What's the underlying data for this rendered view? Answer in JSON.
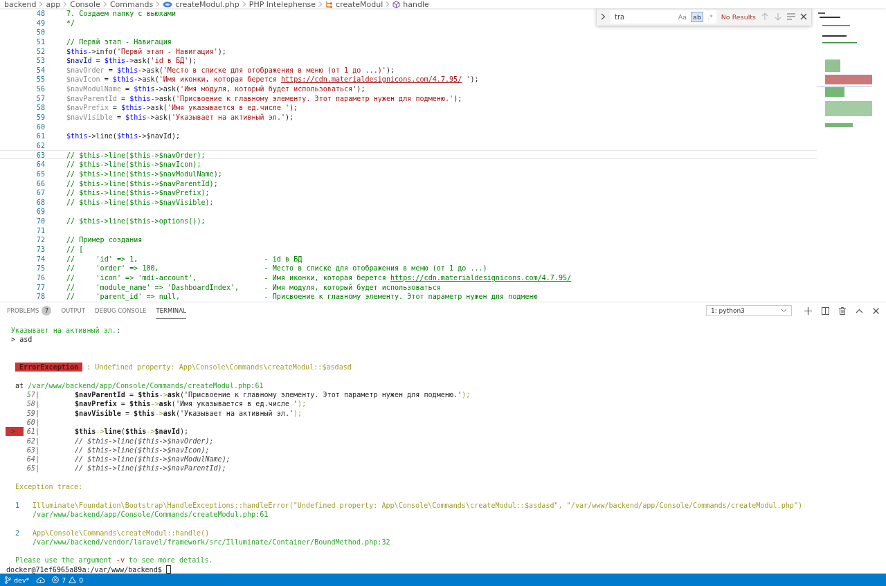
{
  "breadcrumb": [
    {
      "label": "backend",
      "kind": "folder"
    },
    {
      "label": "app",
      "kind": "folder"
    },
    {
      "label": "Console",
      "kind": "folder"
    },
    {
      "label": "Commands",
      "kind": "folder"
    },
    {
      "label": "createModul.php",
      "kind": "file"
    },
    {
      "label": "PHP Intelephense",
      "kind": "folder"
    },
    {
      "label": "createModul",
      "kind": "class"
    },
    {
      "label": "handle",
      "kind": "method"
    }
  ],
  "find_widget": {
    "query": "tra",
    "options": [
      {
        "label": "Aa",
        "selected": false
      },
      {
        "label": "ab",
        "selected": true
      },
      {
        "label": ".*",
        "selected": false
      }
    ],
    "status": "No Results"
  },
  "editor": {
    "lines": [
      {
        "n": "48",
        "current": false,
        "tokens": [
          {
            "kind": "c",
            "text": "7. Создаем папку с вьюхами"
          }
        ]
      },
      {
        "n": "49",
        "current": false,
        "tokens": [
          {
            "kind": "c",
            "text": "*/"
          }
        ]
      },
      {
        "n": "50",
        "current": false
      },
      {
        "n": "51",
        "current": false,
        "tokens": [
          {
            "kind": "c",
            "text": "// Первй этап - Навигация"
          }
        ]
      },
      {
        "n": "52",
        "current": false,
        "tokens": [
          {
            "kind": "t",
            "text": "$this"
          },
          {
            "kind": "p",
            "text": "->info("
          },
          {
            "kind": "s",
            "text": "'Первй этап - Навигация'"
          },
          {
            "kind": "p",
            "text": ");"
          }
        ]
      },
      {
        "n": "53",
        "current": false,
        "tokens": [
          {
            "kind": "v",
            "text": "$navId"
          },
          {
            "kind": "p",
            "text": " = "
          },
          {
            "kind": "t",
            "text": "$this"
          },
          {
            "kind": "p",
            "text": "->ask("
          },
          {
            "kind": "s",
            "text": "'id в БД'"
          },
          {
            "kind": "p",
            "text": ");"
          }
        ]
      },
      {
        "n": "54",
        "current": false,
        "tokens": [
          {
            "kind": "d",
            "text": "$navOrder"
          },
          {
            "kind": "p",
            "text": " = "
          },
          {
            "kind": "t",
            "text": "$this"
          },
          {
            "kind": "p",
            "text": "->ask("
          },
          {
            "kind": "s",
            "text": "'Место в списке для отображения в меню (от 1 до ...)'"
          },
          {
            "kind": "p",
            "text": ");"
          }
        ]
      },
      {
        "n": "55",
        "current": false,
        "tokens": [
          {
            "kind": "d",
            "text": "$navIcon"
          },
          {
            "kind": "p",
            "text": " = "
          },
          {
            "kind": "t",
            "text": "$this"
          },
          {
            "kind": "p",
            "text": "->ask("
          },
          {
            "kind": "s",
            "text": "'Имя иконки, которая берется "
          },
          {
            "kind": "u",
            "text": "https://cdn.materialdesignicons.com/4.7.95/"
          },
          {
            "kind": "s",
            "text": " '"
          },
          {
            "kind": "p",
            "text": ");"
          }
        ]
      },
      {
        "n": "56",
        "current": false,
        "tokens": [
          {
            "kind": "d",
            "text": "$navModulName"
          },
          {
            "kind": "p",
            "text": " = "
          },
          {
            "kind": "t",
            "text": "$this"
          },
          {
            "kind": "p",
            "text": "->ask("
          },
          {
            "kind": "s",
            "text": "'Имя модуля, который будет использоваться'"
          },
          {
            "kind": "p",
            "text": ");"
          }
        ]
      },
      {
        "n": "57",
        "current": false,
        "tokens": [
          {
            "kind": "d",
            "text": "$navParentId"
          },
          {
            "kind": "p",
            "text": " = "
          },
          {
            "kind": "t",
            "text": "$this"
          },
          {
            "kind": "p",
            "text": "->ask("
          },
          {
            "kind": "s",
            "text": "'Присвоение к главному элементу. Этот параметр нужен для подменю.'"
          },
          {
            "kind": "p",
            "text": ");"
          }
        ]
      },
      {
        "n": "58",
        "current": false,
        "tokens": [
          {
            "kind": "d",
            "text": "$navPrefix"
          },
          {
            "kind": "p",
            "text": " = "
          },
          {
            "kind": "t",
            "text": "$this"
          },
          {
            "kind": "p",
            "text": "->ask("
          },
          {
            "kind": "s",
            "text": "'Имя указывается в ед.числе '"
          },
          {
            "kind": "p",
            "text": ");"
          }
        ]
      },
      {
        "n": "59",
        "current": false,
        "tokens": [
          {
            "kind": "d",
            "text": "$navVisible"
          },
          {
            "kind": "p",
            "text": " = "
          },
          {
            "kind": "t",
            "text": "$this"
          },
          {
            "kind": "p",
            "text": "->ask("
          },
          {
            "kind": "s",
            "text": "'Указывает на активный эл.'"
          },
          {
            "kind": "p",
            "text": ");"
          }
        ]
      },
      {
        "n": "60",
        "current": false
      },
      {
        "n": "61",
        "current": false,
        "tokens": [
          {
            "kind": "t",
            "text": "$this"
          },
          {
            "kind": "p",
            "text": "->line("
          },
          {
            "kind": "t",
            "text": "$this"
          },
          {
            "kind": "p",
            "text": "->$navId);"
          }
        ]
      },
      {
        "n": "62",
        "current": false
      },
      {
        "n": "63",
        "current": true,
        "tokens": [
          {
            "kind": "c",
            "text": "// $this->line($this->$navOrder);"
          }
        ]
      },
      {
        "n": "64",
        "current": false,
        "tokens": [
          {
            "kind": "c",
            "text": "// $this->line($this->$navIcon);"
          }
        ]
      },
      {
        "n": "65",
        "current": false,
        "tokens": [
          {
            "kind": "c",
            "text": "// $this->line($this->$navModulName);"
          }
        ]
      },
      {
        "n": "66",
        "current": false,
        "tokens": [
          {
            "kind": "c",
            "text": "// $this->line($this->$navParentId);"
          }
        ]
      },
      {
        "n": "67",
        "current": false,
        "tokens": [
          {
            "kind": "c",
            "text": "// $this->line($this->$navPrefix);"
          }
        ]
      },
      {
        "n": "68",
        "current": false,
        "tokens": [
          {
            "kind": "c",
            "text": "// $this->line($this->$navVisible);"
          }
        ]
      },
      {
        "n": "69",
        "current": false
      },
      {
        "n": "70",
        "current": false,
        "tokens": [
          {
            "kind": "c",
            "text": "// $this->line($this->options());"
          }
        ]
      },
      {
        "n": "71",
        "current": false
      },
      {
        "n": "72",
        "current": false,
        "tokens": [
          {
            "kind": "c",
            "text": "// Пример создания"
          }
        ]
      },
      {
        "n": "73",
        "current": false,
        "tokens": [
          {
            "kind": "c",
            "text": "// ["
          }
        ]
      },
      {
        "n": "74",
        "current": false,
        "tokens": [
          {
            "kind": "c",
            "text": "//     'id' => 1,                              - id в БД"
          }
        ]
      },
      {
        "n": "75",
        "current": false,
        "tokens": [
          {
            "kind": "c",
            "text": "//     'order' => 100,                         - Место в списке для отображения в меню (от 1 до ...)"
          }
        ]
      },
      {
        "n": "76",
        "current": false,
        "tokens": [
          {
            "kind": "c",
            "text": "//     'icon' => 'mdi-account',                - Имя иконки, которая берется "
          },
          {
            "kind": "cu",
            "text": "https://cdn.materialdesignicons.com/4.7.95/"
          }
        ]
      },
      {
        "n": "77",
        "current": false,
        "tokens": [
          {
            "kind": "c",
            "text": "//     'module_name' => 'DashboardIndex',      - Имя модуля, который будет использоваться"
          }
        ]
      },
      {
        "n": "78",
        "current": false,
        "tokens": [
          {
            "kind": "c",
            "text": "//     'parent_id' => null,                    - Присвоение к главному элементу. Этот параметр нужен для подменю"
          }
        ]
      }
    ]
  },
  "panel": {
    "tabs": [
      {
        "label": "PROBLEMS",
        "badge": "7",
        "selected": false
      },
      {
        "label": "OUTPUT",
        "selected": false
      },
      {
        "label": "DEBUG CONSOLE",
        "selected": false
      },
      {
        "label": "TERMINAL",
        "selected": true
      }
    ],
    "terminal_select": "1: python3",
    "terminal": [
      {
        "kind": "prompt",
        "tokens": [
          {
            "kind": "g",
            "text": "Указывает на активный эл."
          },
          {
            "kind": "p",
            "text": ":"
          }
        ]
      },
      {
        "kind": "prompt",
        "tokens": [
          {
            "kind": "p",
            "text": "> asd"
          }
        ]
      },
      {
        "kind": "blank"
      },
      {
        "kind": "blank"
      },
      {
        "kind": "error",
        "badge": "ErrorException",
        "tokens": [
          {
            "kind": "y",
            "text": ": Undefined property: App\\Console\\Commands\\createModul::$asdasd"
          }
        ]
      },
      {
        "kind": "blank"
      },
      {
        "kind": "text",
        "tokens": [
          {
            "kind": "p",
            "text": "at "
          },
          {
            "kind": "g",
            "text": "/var/www/backend/app/Console/Commands/createModul.php"
          },
          {
            "kind": "p",
            "text": ":"
          },
          {
            "kind": "g",
            "text": "61"
          }
        ]
      },
      {
        "kind": "source",
        "n": "57|",
        "tokens": [
          {
            "kind": "b",
            "text": "$navParentId"
          },
          {
            "kind": "p",
            "text": " = "
          },
          {
            "kind": "b",
            "text": "$this"
          },
          {
            "kind": "o",
            "text": "->"
          },
          {
            "kind": "b",
            "text": "ask"
          },
          {
            "kind": "p",
            "text": "("
          },
          {
            "kind": "p",
            "text": "'Присвоение к главному элементу. Этот параметр нужен для подменю.'"
          },
          {
            "kind": "o",
            "text": ");"
          }
        ]
      },
      {
        "kind": "source",
        "n": "58|",
        "tokens": [
          {
            "kind": "b",
            "text": "$navPrefix"
          },
          {
            "kind": "p",
            "text": " = "
          },
          {
            "kind": "b",
            "text": "$this"
          },
          {
            "kind": "o",
            "text": "->"
          },
          {
            "kind": "b",
            "text": "ask"
          },
          {
            "kind": "p",
            "text": "("
          },
          {
            "kind": "p",
            "text": "'Имя указывается в ед.числе '"
          },
          {
            "kind": "o",
            "text": ");"
          }
        ]
      },
      {
        "kind": "source",
        "n": "59|",
        "tokens": [
          {
            "kind": "b",
            "text": "$navVisible"
          },
          {
            "kind": "p",
            "text": " = "
          },
          {
            "kind": "b",
            "text": "$this"
          },
          {
            "kind": "o",
            "text": "->"
          },
          {
            "kind": "b",
            "text": "ask"
          },
          {
            "kind": "p",
            "text": "("
          },
          {
            "kind": "p",
            "text": "'Указывает на активный эл.'"
          },
          {
            "kind": "o",
            "text": ");"
          }
        ]
      },
      {
        "kind": "source",
        "n": "60|"
      },
      {
        "kind": "source",
        "n": "61|",
        "pointer": ">",
        "tokens": [
          {
            "kind": "b",
            "text": "$this"
          },
          {
            "kind": "o",
            "text": "->"
          },
          {
            "kind": "b",
            "text": "line"
          },
          {
            "kind": "p",
            "text": "("
          },
          {
            "kind": "b",
            "text": "$this"
          },
          {
            "kind": "o",
            "text": "->"
          },
          {
            "kind": "b",
            "text": "$navId"
          },
          {
            "kind": "p",
            "text": ");"
          }
        ]
      },
      {
        "kind": "source",
        "n": "62|",
        "tokens": [
          {
            "kind": "i",
            "text": "// $this->line($this->$navOrder);"
          }
        ]
      },
      {
        "kind": "source",
        "n": "63|",
        "tokens": [
          {
            "kind": "i",
            "text": "// $this->line($this->$navIcon);"
          }
        ]
      },
      {
        "kind": "source",
        "n": "64|",
        "tokens": [
          {
            "kind": "i",
            "text": "// $this->line($this->$navModulName);"
          }
        ]
      },
      {
        "kind": "source",
        "n": "65|",
        "tokens": [
          {
            "kind": "i",
            "text": "// $this->line($this->$navParentId);"
          }
        ]
      },
      {
        "kind": "blank"
      },
      {
        "kind": "text",
        "tokens": [
          {
            "kind": "y",
            "text": "Exception trace:"
          }
        ]
      },
      {
        "kind": "blank"
      },
      {
        "kind": "trace",
        "n": "1",
        "tokens": [
          {
            "kind": "y",
            "text": "Illuminate\\Foundation\\Bootstrap\\HandleExceptions::handleError(\"Undefined property: App\\Console\\Commands\\createModul::$asdasd\", \"/var/www/backend/app/Console/Commands/createModul.php\")"
          }
        ]
      },
      {
        "kind": "trace",
        "tokens": [
          {
            "kind": "g",
            "text": "/var/www/backend/app/Console/Commands/createModul.php:61"
          }
        ]
      },
      {
        "kind": "blank"
      },
      {
        "kind": "trace",
        "n": "2",
        "tokens": [
          {
            "kind": "y",
            "text": "App\\Console\\Commands\\createModul::handle()"
          }
        ]
      },
      {
        "kind": "trace",
        "tokens": [
          {
            "kind": "g",
            "text": "/var/www/backend/vendor/laravel/framework/src/Illuminate/Container/BoundMethod.php:32"
          }
        ]
      },
      {
        "kind": "blank"
      },
      {
        "kind": "text",
        "tokens": [
          {
            "kind": "g",
            "text": "Please use the argument "
          },
          {
            "kind": "r",
            "text": "-v"
          },
          {
            "kind": "g",
            "text": " to see more details."
          }
        ]
      },
      {
        "kind": "shell",
        "prompt": "docker@71ef6965a89a:/var/www/backend$"
      }
    ]
  },
  "status_bar": {
    "branch": "dev*",
    "errors": "7",
    "warnings": "0"
  }
}
